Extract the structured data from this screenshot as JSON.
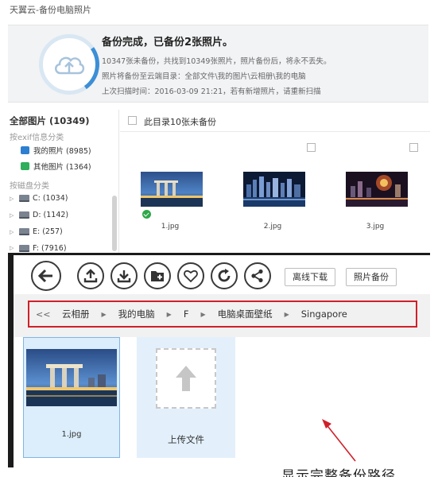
{
  "window_title": "天翼云-备份电脑照片",
  "banner": {
    "title": "备份完成，已备份2张照片。",
    "lines": [
      "10347张未备份，共找到10349张照片，照片备份后，将永不丢失。",
      "照片将备份至云端目录：全部文件\\我的图片\\云相册\\我的电脑",
      "上次扫描时间：2016-03-09 21:21，若有新增照片，请重新扫描"
    ]
  },
  "left_panel": {
    "title": "全部图片 (10349)",
    "exif_section": "按exif信息分类",
    "exif_items": [
      {
        "label": "我的照片 (8985)",
        "icon": "photo-icon"
      },
      {
        "label": "其他图片 (1364)",
        "icon": "image-icon"
      }
    ],
    "disk_section": "按磁盘分类",
    "disks": [
      {
        "label": "C: (1034)"
      },
      {
        "label": "D: (1142)"
      },
      {
        "label": "E: (257)"
      },
      {
        "label": "F: (7916)"
      }
    ]
  },
  "right_panel": {
    "header_label": "此目录10张未备份",
    "photos": [
      {
        "name": "1.jpg",
        "backed_up": true
      },
      {
        "name": "2.jpg",
        "backed_up": false
      },
      {
        "name": "3.jpg",
        "backed_up": false
      }
    ]
  },
  "toolbar": {
    "buttons": [
      "back-icon",
      "upload-icon",
      "download-icon",
      "add-folder-icon",
      "heart-icon",
      "refresh-icon",
      "share-icon"
    ],
    "offline_download_label": "离线下载",
    "photo_backup_label": "照片备份"
  },
  "breadcrumb": {
    "back_label": "<<",
    "items": [
      "云相册",
      "我的电脑",
      "F",
      "电脑桌面壁纸",
      "Singapore"
    ],
    "highlight_color": "#d0202a"
  },
  "files": [
    {
      "name": "1.jpg"
    }
  ],
  "upload_label": "上传文件",
  "annotation": "显示完整备份路径"
}
